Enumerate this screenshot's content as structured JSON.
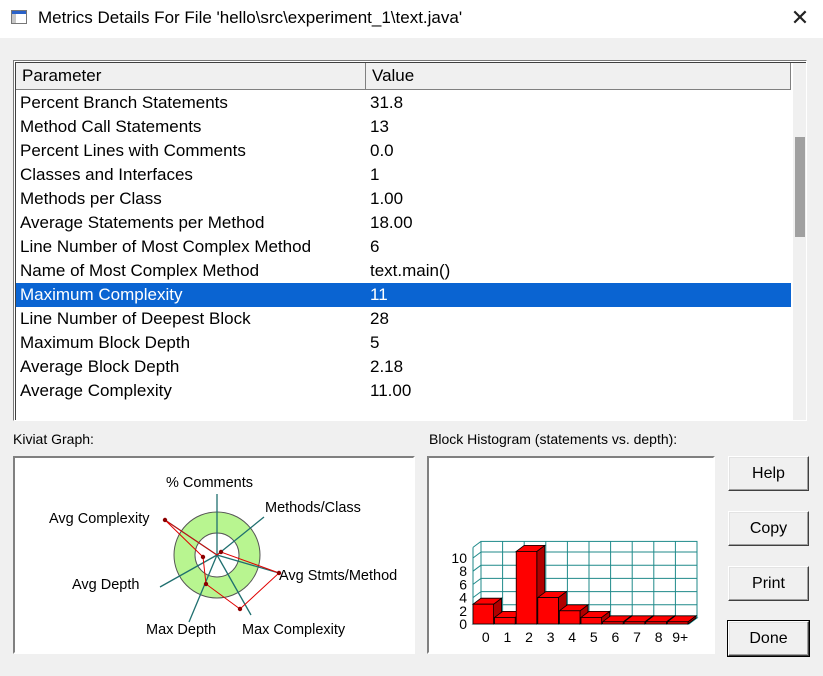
{
  "window": {
    "title": "Metrics Details For File 'hello\\src\\experiment_1\\text.java'",
    "close_glyph": "✕"
  },
  "table": {
    "headers": {
      "parameter": "Parameter",
      "value": "Value"
    },
    "rows": [
      {
        "parameter": "Percent Branch Statements",
        "value": "31.8"
      },
      {
        "parameter": "Method Call Statements",
        "value": "13"
      },
      {
        "parameter": "Percent Lines with Comments",
        "value": "0.0"
      },
      {
        "parameter": "Classes and Interfaces",
        "value": "1"
      },
      {
        "parameter": "Methods per Class",
        "value": "1.00"
      },
      {
        "parameter": "Average Statements per Method",
        "value": "18.00"
      },
      {
        "parameter": "Line Number of Most Complex Method",
        "value": "6"
      },
      {
        "parameter": "Name of Most Complex Method",
        "value": "text.main()"
      },
      {
        "parameter": "Maximum Complexity",
        "value": "11",
        "selected": true
      },
      {
        "parameter": "Line Number of Deepest Block",
        "value": "28"
      },
      {
        "parameter": "Maximum Block Depth",
        "value": "5"
      },
      {
        "parameter": "Average Block Depth",
        "value": "2.18"
      },
      {
        "parameter": "Average Complexity",
        "value": "11.00"
      }
    ],
    "selected_color": "#0a64d2"
  },
  "kiviat": {
    "label": "Kiviat Graph:",
    "axes": {
      "comments": "% Comments",
      "methods_class": "Methods/Class",
      "avg_stmts": "Avg Stmts/Method",
      "max_complexity": "Max Complexity",
      "max_depth": "Max Depth",
      "avg_depth": "Avg Depth",
      "avg_complexity": "Avg Complexity"
    },
    "ring_color": "#b8f590",
    "polygon_color": "#e00000"
  },
  "histogram": {
    "label": "Block Histogram (statements vs. depth):",
    "bar_color": "#ff0000",
    "grid_color": "#1f8a8a"
  },
  "chart_data": {
    "type": "bar",
    "title": "Block Histogram (statements vs. depth):",
    "categories": [
      "0",
      "1",
      "2",
      "3",
      "4",
      "5",
      "6",
      "7",
      "8",
      "9+"
    ],
    "values": [
      3,
      1,
      11,
      4,
      2,
      1,
      0,
      0,
      0,
      0
    ],
    "y_ticks": [
      "0",
      "2",
      "4",
      "6",
      "8",
      "10"
    ],
    "ylim": [
      0,
      11
    ]
  },
  "buttons": {
    "help": "Help",
    "copy": "Copy",
    "print": "Print",
    "done": "Done"
  }
}
